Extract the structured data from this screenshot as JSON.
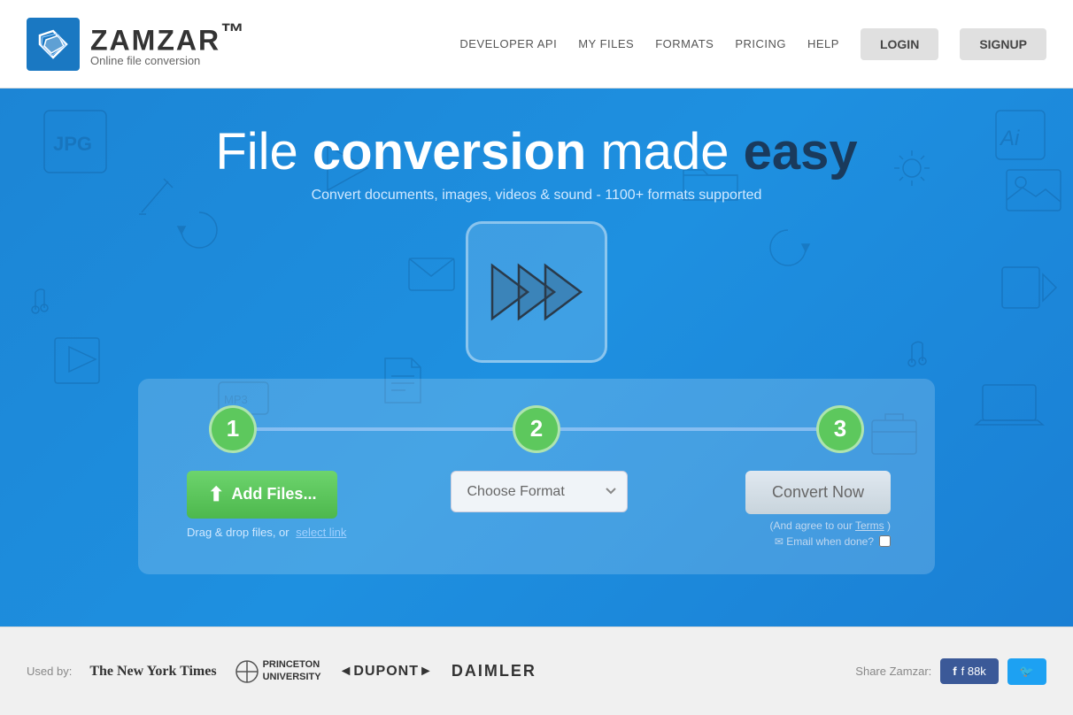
{
  "header": {
    "logo_name": "ZAMZAR",
    "logo_tm": "™",
    "logo_tagline": "Online file conversion",
    "nav": {
      "developer_api": "DEVELOPER API",
      "my_files": "MY FILES",
      "formats": "FORMATS",
      "pricing": "PRICING",
      "help": "HELP",
      "login": "LOGIN",
      "signup": "SIGNUP"
    }
  },
  "hero": {
    "title_prefix": "File ",
    "title_bold": "conversion",
    "title_middle": " made ",
    "title_dark": "easy",
    "subtitle": "Convert documents, images, videos & sound - 1100+ formats supported"
  },
  "conversion": {
    "step1_label": "1",
    "step2_label": "2",
    "step3_label": "3",
    "add_files_label": "Add Files...",
    "drag_drop_text": "Drag & drop files, or",
    "select_link_text": "select link",
    "choose_format_label": "Choose Format",
    "choose_format_arrow": "▾",
    "convert_now_label": "Convert Now",
    "agree_text": "(And agree to our",
    "agree_terms": "Terms",
    "agree_end": ")",
    "email_label": "✉ Email when done?"
  },
  "footer": {
    "used_by_label": "Used by:",
    "brands": [
      "The New York Times",
      "PRINCETON UNIVERSITY",
      "◄DUPONT►",
      "DAIMLER"
    ],
    "share_label": "Share Zamzar:",
    "fb_label": "f  88k",
    "tw_label": "🐦"
  }
}
